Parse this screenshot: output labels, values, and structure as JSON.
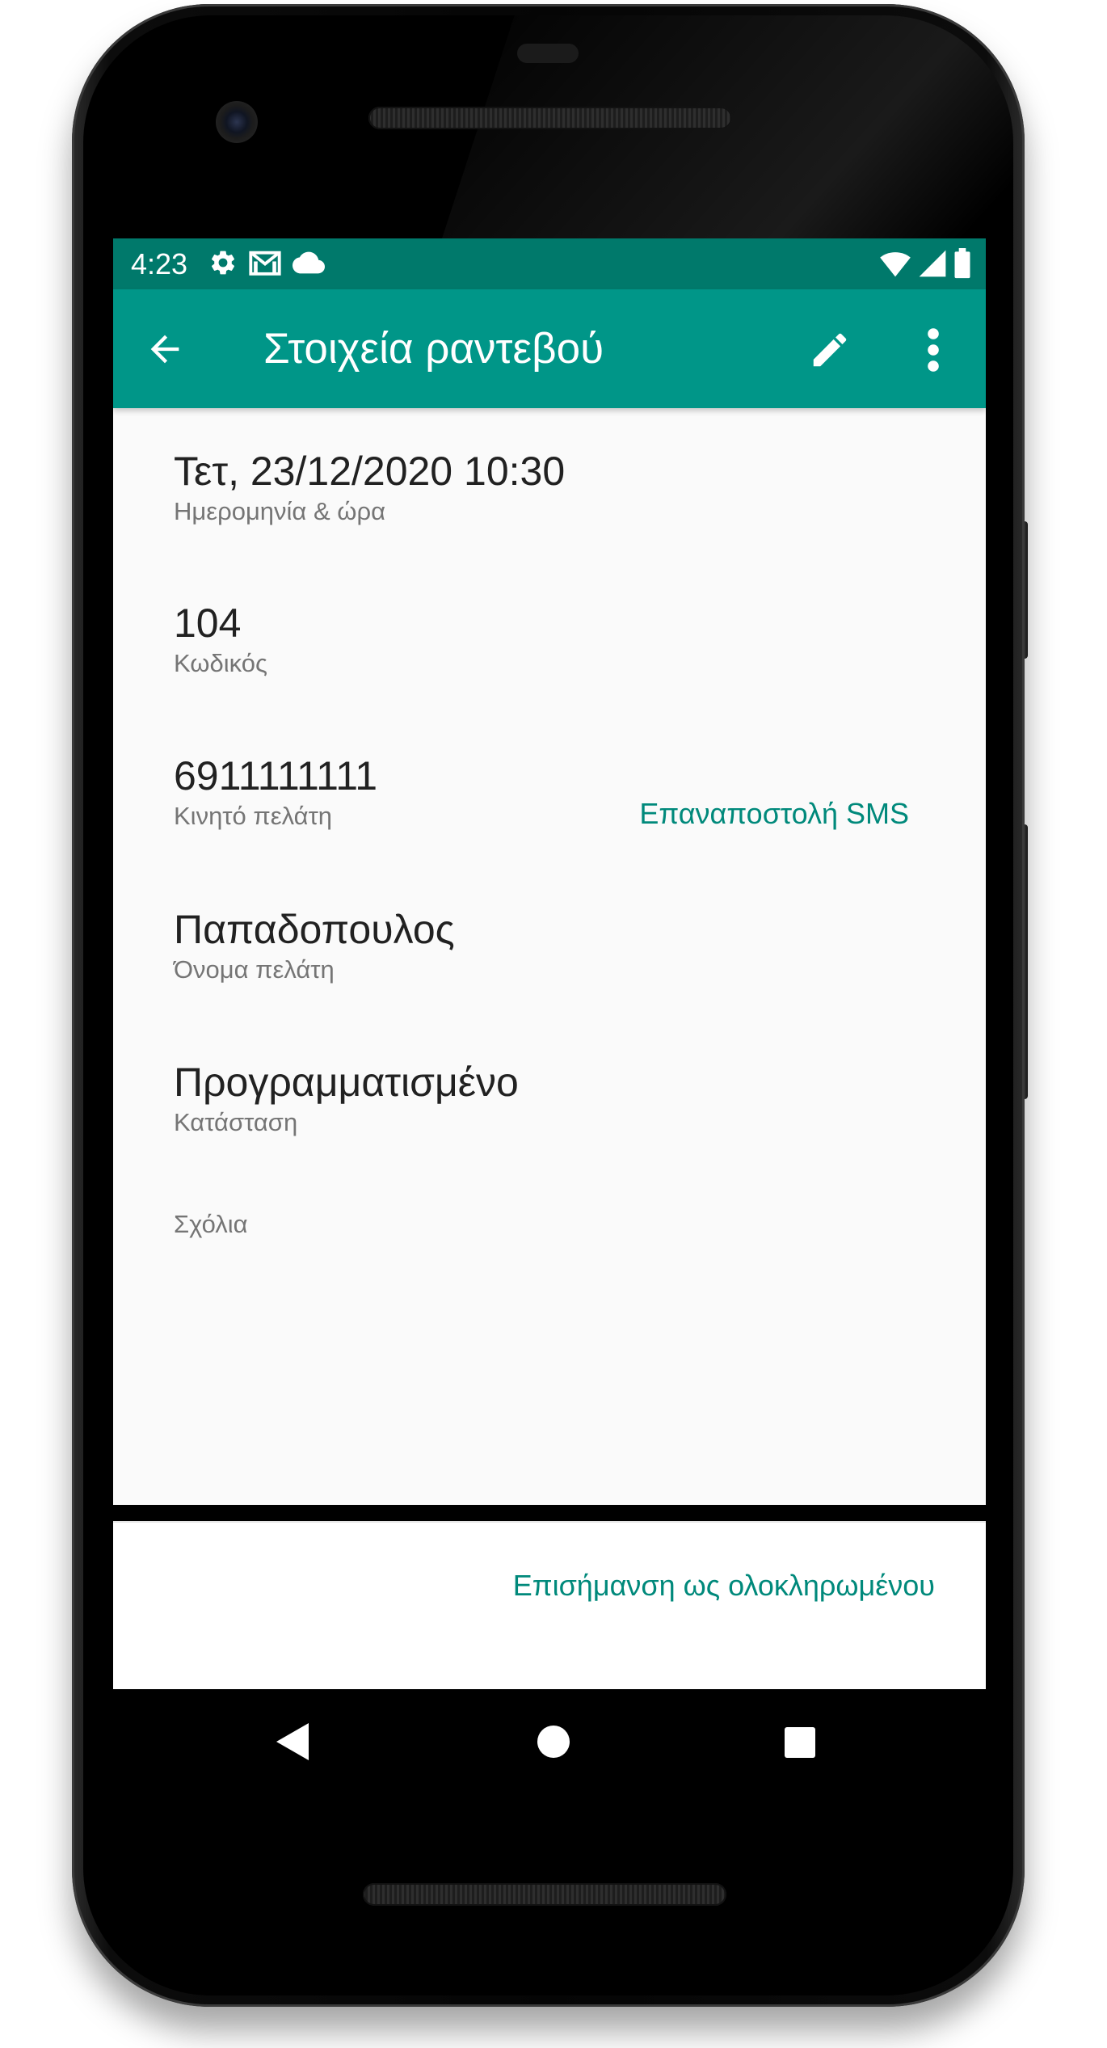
{
  "status_bar": {
    "time": "4:23",
    "left_icons": [
      "settings-gear-icon",
      "gmail-icon",
      "cloud-icon"
    ],
    "right_icons": [
      "wifi-icon",
      "cell-signal-icon",
      "battery-icon"
    ]
  },
  "app_bar": {
    "title": "Στοιχεία ραντεβού",
    "back_icon": "arrow-back-icon",
    "edit_icon": "pencil-icon",
    "menu_icon": "more-vert-icon"
  },
  "details": {
    "datetime": {
      "value": "Τετ, 23/12/2020 10:30",
      "label": "Ημερομηνία & ώρα"
    },
    "code": {
      "value": "104",
      "label": "Κωδικός"
    },
    "mobile": {
      "value": "6911111111",
      "label": "Κινητό πελάτη",
      "action": "Επαναποστολή SMS"
    },
    "name": {
      "value": "Παπαδοπουλος",
      "label": "Όνομα πελάτη"
    },
    "status": {
      "value": "Προγραμματισμένο",
      "label": "Κατάσταση"
    },
    "comments": {
      "value": "",
      "label": "Σχόλια"
    }
  },
  "footer": {
    "mark_complete": "Επισήμανση ως ολοκληρωμένου"
  },
  "navigation": {
    "back": "nav-back-triangle-icon",
    "home": "nav-home-circle-icon",
    "recents": "nav-recents-square-icon"
  },
  "colors": {
    "status_bar": "#00796b",
    "app_bar": "#009688",
    "accent_text": "#00897b"
  }
}
